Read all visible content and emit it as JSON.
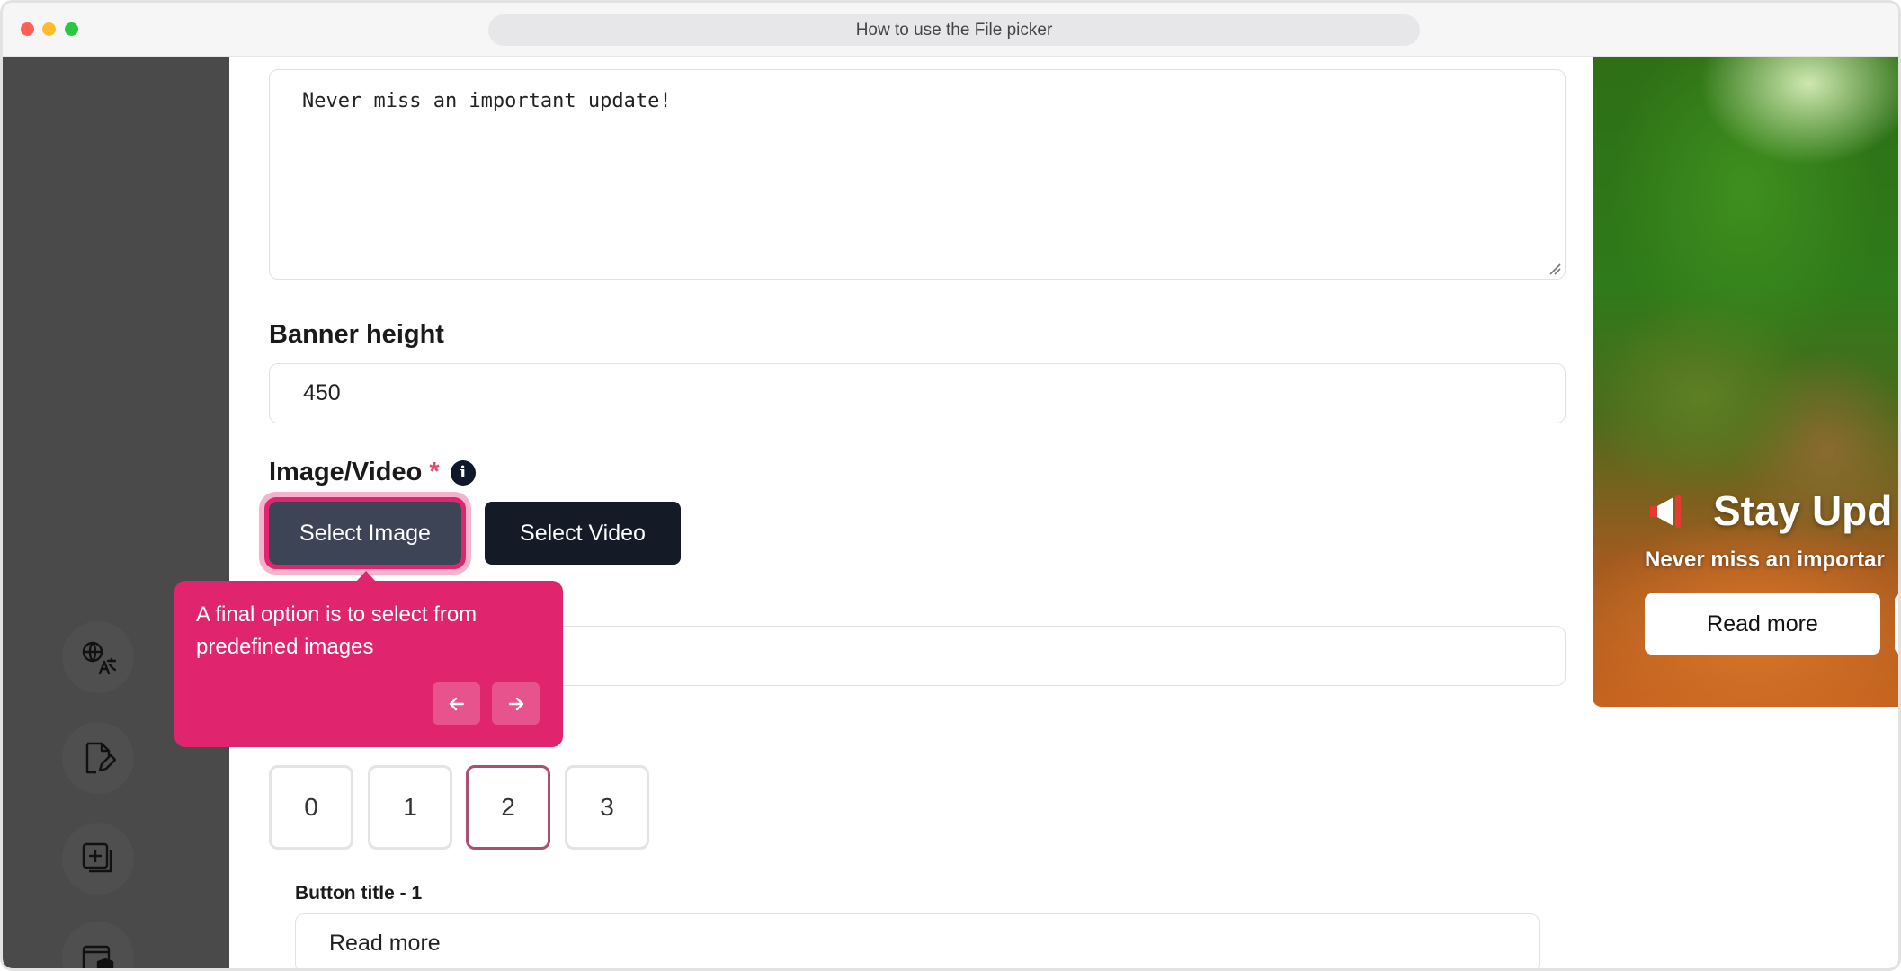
{
  "window": {
    "title": "How to use the File picker"
  },
  "sidebar": {
    "items": [
      {
        "icon": "translate-icon"
      },
      {
        "icon": "edit-document-icon"
      },
      {
        "icon": "add-copy-icon"
      },
      {
        "icon": "shield-card-icon"
      }
    ]
  },
  "form": {
    "message_value": "Never miss an important update!",
    "banner_height_label": "Banner height",
    "banner_height_value": "450",
    "media_label": "Image/Video",
    "required_mark": "*",
    "info_glyph": "i",
    "select_image_label": "Select Image",
    "select_video_label": "Select Video",
    "button_count_options": [
      "0",
      "1",
      "2",
      "3"
    ],
    "button_count_selected": "2",
    "button_title_label": "Button title - 1",
    "button_title_value": "Read more"
  },
  "tooltip": {
    "text": "A final option is to select from predefined images",
    "prev_icon": "arrow-left-icon",
    "next_icon": "arrow-right-icon",
    "color": "#e0246e"
  },
  "preview": {
    "title": "Stay Upd",
    "subtitle": "Never miss an importar",
    "button_label": "Read more"
  },
  "colors": {
    "accent": "#e0246e",
    "dark_button": "#141a26",
    "sidebar": "#4a4a4a"
  }
}
